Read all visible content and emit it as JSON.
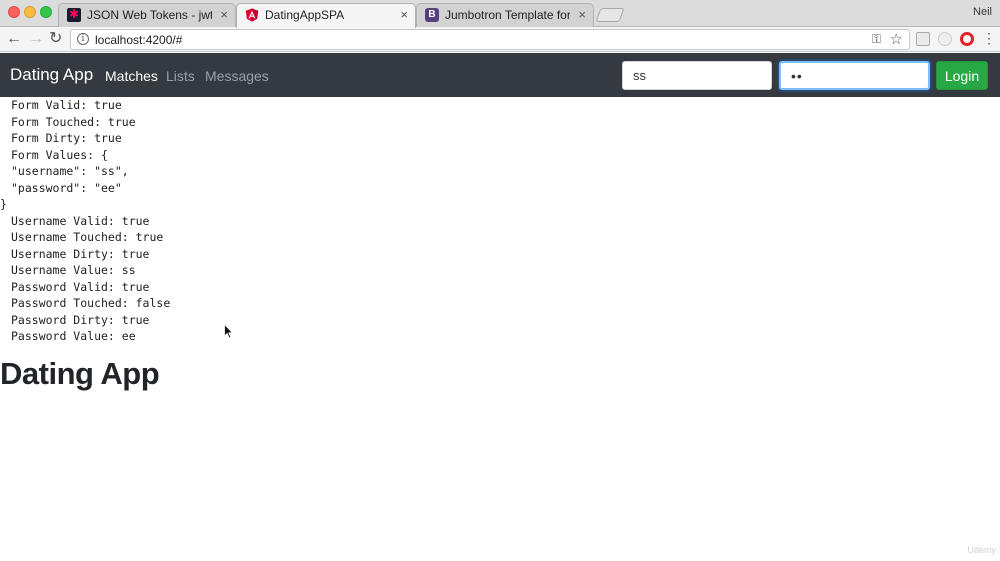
{
  "browser": {
    "tabs": [
      {
        "title": "JSON Web Tokens - jwt.io",
        "close": "×"
      },
      {
        "title": "DatingAppSPA",
        "close": "×"
      },
      {
        "title": "Jumbotron Template for Boots",
        "close": "×",
        "icon_letter": "B"
      }
    ],
    "profile_name": "Neil",
    "address": "localhost:4200/#",
    "info_glyph": "i"
  },
  "navbar": {
    "brand": "Dating App",
    "links": [
      "Matches",
      "Lists",
      "Messages"
    ],
    "username_value": "ss",
    "password_value": "ee",
    "login_label": "Login"
  },
  "debug_lines": [
    "Form Valid: true",
    "Form Touched: true",
    "Form Dirty: true",
    "Form Values: {",
    "\"username\": \"ss\",",
    "\"password\": \"ee\"",
    "}",
    "Username Valid: true",
    "Username Touched: true",
    "Username Dirty: true",
    "Username Value: ss",
    "Password Valid: true",
    "Password Touched: false",
    "Password Dirty: true",
    "Password Value: ee"
  ],
  "main_heading": "Dating App",
  "watermark": "Udemy",
  "colors": {
    "navbar_bg": "#343a40",
    "login_green": "#28a745",
    "focus_blue": "#80bdff"
  }
}
